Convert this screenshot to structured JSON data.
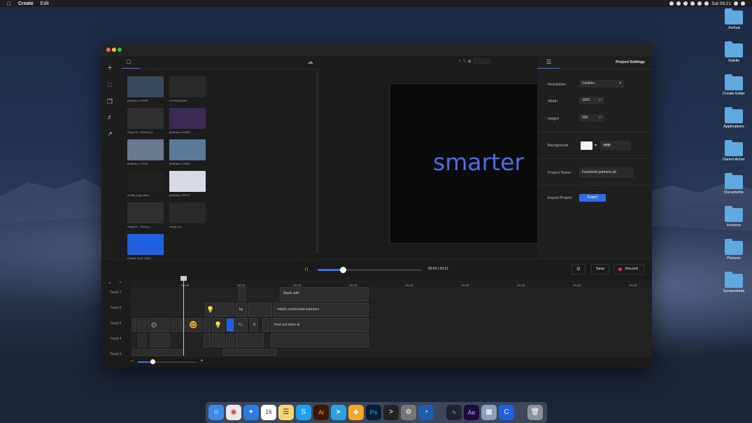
{
  "menubar": {
    "app": "Create",
    "edit": "Edit",
    "time": "Sat 09:21"
  },
  "desktop_icons": [
    "Joshua",
    "Vidello",
    "Create folder",
    "Applications",
    "Daniel-Acher",
    "Documents",
    "Invoices",
    "Pictures",
    "Screenshots"
  ],
  "media": {
    "items": [
      {
        "caption": "pixabay-v-54155",
        "color": "#3a4a5e"
      },
      {
        "caption": "c:\\ohtes\\chiller",
        "color": "#2a2a2a"
      },
      {
        "caption": "Song 24 - Stomp (1)",
        "color": "#2f2f2f"
      },
      {
        "caption": "pixabay-v-14409",
        "color": "#3b2a54"
      },
      {
        "caption": "pixabay-v-13112",
        "color": "#6a7a90"
      },
      {
        "caption": "pixabay-v-14205",
        "color": "#5a7a9a"
      },
      {
        "caption": "create_logo_blac...",
        "color": "#202020"
      },
      {
        "caption": "pixabay-v-20072",
        "color": "#d8dce2"
      },
      {
        "caption": "Song 24 - Stomp (...",
        "color": "#2f2f2f"
      },
      {
        "caption": "cough (1)",
        "color": "#2a2a2a"
      },
      {
        "caption": "Create_Icon_1024",
        "color": "#1f5fe0"
      }
    ]
  },
  "canvas": {
    "text": "smarter"
  },
  "settings": {
    "title": "Project Settings",
    "resolution_label": "Resolution",
    "resolution_value": "Custom..",
    "width_label": "Width",
    "width_value": "1000",
    "height_label": "Height",
    "height_value": "900",
    "unit": "px",
    "background_label": "Background",
    "background_hex": "#ffffff",
    "project_name_label": "Project Name",
    "project_name_value": "Facebook partners ad",
    "export_label": "Export Project",
    "export_button": "Export"
  },
  "playbar": {
    "time": "00:00 | 00:21",
    "progress": 0.24,
    "save": "Save",
    "record": "Record"
  },
  "timeline": {
    "ticks": [
      "00:05",
      "00:10",
      "00:15",
      "00:20",
      "00:25",
      "00:30",
      "00:35",
      "00:40",
      "00:45"
    ],
    "tracks": [
      "Track 7",
      "Track 6",
      "Track 5",
      "Track 4",
      "Track 3"
    ],
    "clip_made_with": "Made with",
    "clip_by": "by",
    "clip_url": "vidello.com/create-partners",
    "clip_cr": "Cr...",
    "clip_s": "S",
    "clip_find": "Find out more at",
    "zoom": 0.25
  },
  "colors": {
    "accent": "#3a6df0",
    "record": "#e0313a"
  }
}
